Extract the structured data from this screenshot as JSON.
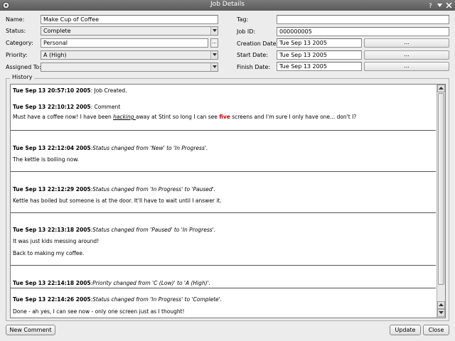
{
  "window": {
    "title": "Job Details"
  },
  "form": {
    "name_label": "Name:",
    "name_value": "Make Cup of Coffee",
    "status_label": "Status:",
    "status_value": "Complete",
    "category_label": "Category:",
    "category_value": "Personal",
    "category_button": "...",
    "priority_label": "Priority:",
    "priority_value": "A (High)",
    "assigned_label": "Assigned To:",
    "assigned_value": "",
    "tag_label": "Tag:",
    "tag_value": "",
    "jobid_label": "Job ID:",
    "jobid_value": "000000005",
    "creation_label": "Creation Date:",
    "creation_value": "Tue Sep 13 2005",
    "start_label": "Start Date:",
    "start_value": "Tue Sep 13 2005",
    "finish_label": "Finish Date:",
    "finish_value": "Tue Sep 13 2005",
    "date_button": "..."
  },
  "history": {
    "label": "History",
    "e1_ts": "Tue Sep 13 20:57:10 2005",
    "e1_msg": ": Job Created.",
    "e2_ts": "Tue Sep 13 22:10:12 2005",
    "e2_msg": ": Comment",
    "e2_body_a": "Must have a coffee now! I have been ",
    "e2_body_hacking": "hacking ",
    "e2_body_b": "away at Stint so long I can see ",
    "e2_body_five": "five",
    "e2_body_c": " screens and I'm sure I only have one... don't I?",
    "e3_ts": "Tue Sep 13 22:12:04 2005",
    "e3_msg": ":Status changed from 'New' to 'In Progress'.",
    "e3_body": "The kettle is boiling now.",
    "e4_ts": "Tue Sep 13 22:12:29 2005",
    "e4_msg": ":Status changed from 'In Progress' to 'Paused'.",
    "e4_body": "Kettle has boiled but someone is at the door.  It'll have to wait until I answer it.",
    "e5_ts": "Tue Sep 13 22:13:18 2005",
    "e5_msg": ":Status changed from 'Paused' to 'In Progress'.",
    "e5_body1": "It was just kids messing around!",
    "e5_body2": "Back to making my coffee.",
    "e6_ts": "Tue Sep 13 22:14:18 2005",
    "e6_msg": ":Priority changed from 'C (Low)' to 'A (High)'.",
    "e7_ts": "Tue Sep 13 22:14:26 2005",
    "e7_msg": ":Status changed from 'In Progress' to 'Complete'.",
    "e7_body": "Done - ah yes, I can see now - only one screen just as I thought!"
  },
  "buttons": {
    "new_comment": "New Comment",
    "update": "Update",
    "close": "Close"
  },
  "icons": {
    "window_menu": "window-menu-icon",
    "help": "help-icon",
    "minimize": "minimize-icon",
    "close": "close-icon"
  },
  "colors": {
    "highlight_red": "#d00000",
    "titlebar": "#666666"
  }
}
